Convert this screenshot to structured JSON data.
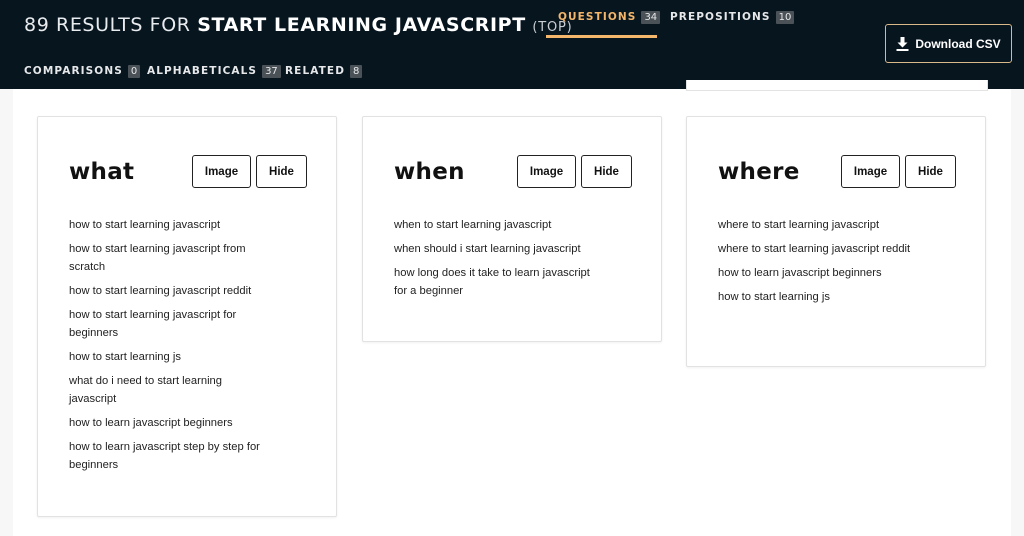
{
  "header": {
    "count_prefix": "89 RESULTS FOR",
    "query": "START LEARNING JAVASCRIPT",
    "sort": "(TOP)",
    "tabs": [
      {
        "label": "QUESTIONS",
        "count": "34"
      },
      {
        "label": "PREPOSITIONS",
        "count": "10"
      },
      {
        "label": "COMPARISONS",
        "count": "0"
      },
      {
        "label": "ALPHABETICALS",
        "count": "37"
      },
      {
        "label": "RELATED",
        "count": "8"
      }
    ],
    "active_tab": "QUESTIONS",
    "download_label": "Download CSV",
    "download_icon": "download-icon"
  },
  "colors": {
    "header_bg": "#07151f",
    "accent": "#f3b66a",
    "page_bg": "#f7f7f7"
  },
  "cards": [
    {
      "title": "what",
      "image_label": "Image",
      "hide_label": "Hide",
      "items": [
        "how to start learning javascript",
        "how to start learning javascript from scratch",
        "how to start learning javascript reddit",
        "how to start learning javascript for beginners",
        "how to start learning js",
        "what do i need to start learning javascript",
        "how to learn javascript beginners",
        "how to learn javascript step by step for beginners"
      ]
    },
    {
      "title": "when",
      "image_label": "Image",
      "hide_label": "Hide",
      "items": [
        "when to start learning javascript",
        "when should i start learning javascript",
        "how long does it take to learn javascript for a beginner"
      ]
    },
    {
      "title": "where",
      "image_label": "Image",
      "hide_label": "Hide",
      "items": [
        "where to start learning javascript",
        "where to start learning javascript reddit",
        "how to learn javascript beginners",
        "how to start learning js"
      ]
    }
  ]
}
